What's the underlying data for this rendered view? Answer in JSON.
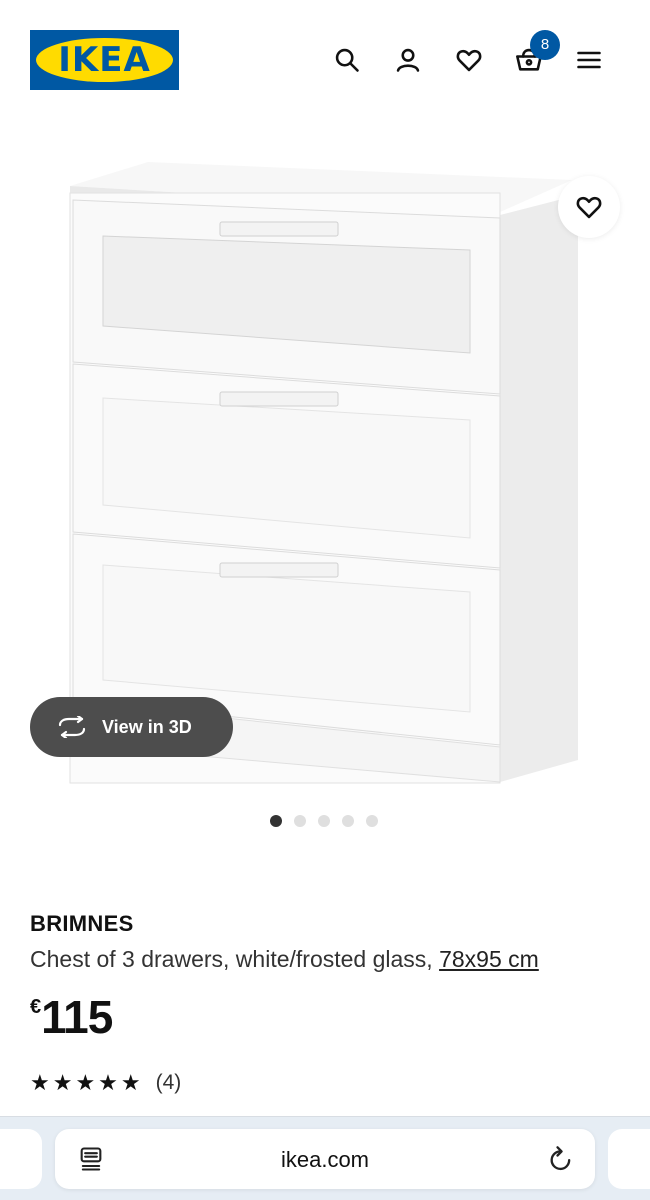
{
  "header": {
    "logo_text": "IKEA",
    "cart_count": "8",
    "icons": [
      "search-icon",
      "user-icon",
      "heart-icon",
      "basket-icon",
      "menu-icon"
    ]
  },
  "product": {
    "image_alt": "white chest of drawers",
    "view3d_label": "View in 3D",
    "carousel_total": 5,
    "carousel_active": 1,
    "name": "BRIMNES",
    "description": "Chest of 3 drawers, white/frosted glass,",
    "dimensions": "78x95 cm",
    "currency": "€",
    "price": "115",
    "rating_stars": "★★★★★",
    "rating_count": "(4)"
  },
  "browser": {
    "url": "ikea.com"
  },
  "colors": {
    "ikea_blue": "#0058a3",
    "ikea_yellow": "#ffdb00",
    "view3d_bg": "#4d4d4d"
  }
}
